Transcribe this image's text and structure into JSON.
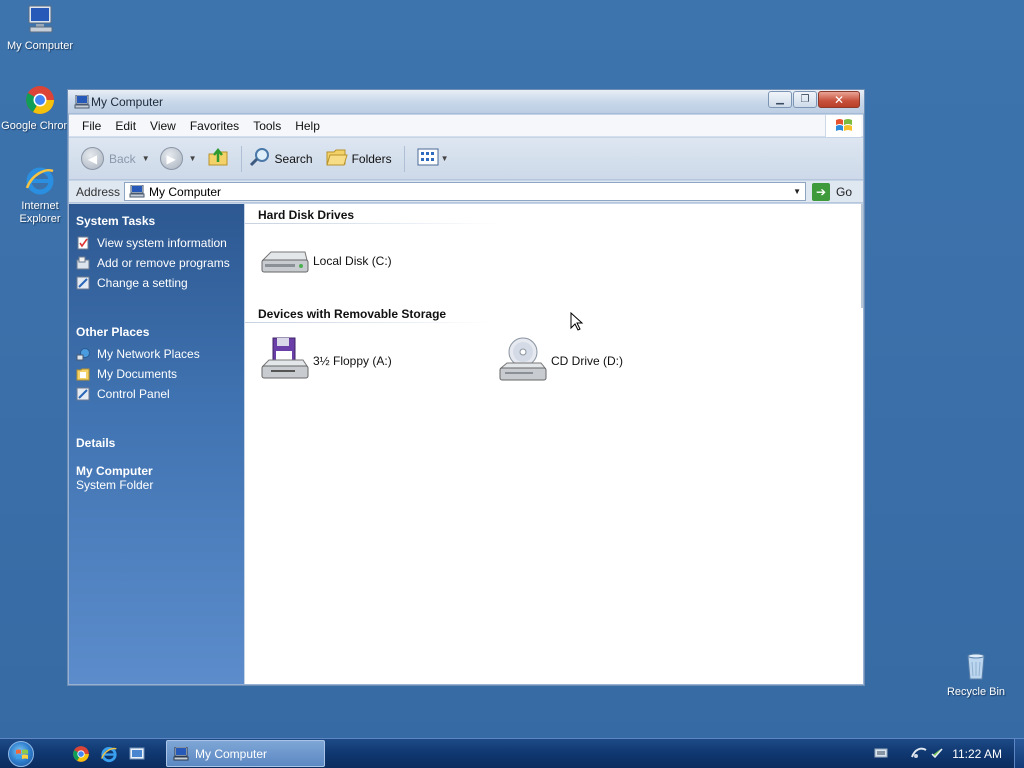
{
  "desktop": {
    "icons": [
      {
        "label": "My Computer",
        "icon": "my-computer-icon"
      },
      {
        "label": "Google Chrome",
        "icon": "chrome-icon"
      },
      {
        "label": "Internet Explorer",
        "icon": "internet-explorer-icon"
      },
      {
        "label": "Recycle Bin",
        "icon": "recycle-bin-icon"
      }
    ]
  },
  "window": {
    "title": "My Computer",
    "menu": [
      "File",
      "Edit",
      "View",
      "Favorites",
      "Tools",
      "Help"
    ],
    "toolbar": {
      "back_label": "Back",
      "search_label": "Search",
      "folders_label": "Folders"
    },
    "address": {
      "label": "Address",
      "value": "My Computer",
      "go_label": "Go"
    },
    "taskpane": {
      "system_tasks": {
        "title": "System Tasks",
        "items": [
          "View system information",
          "Add or remove programs",
          "Change a setting"
        ]
      },
      "other_places": {
        "title": "Other Places",
        "items": [
          "My Network Places",
          "My Documents",
          "Control Panel"
        ]
      },
      "details": {
        "title": "Details",
        "name": "My Computer",
        "type": "System Folder"
      }
    },
    "content": {
      "groups": [
        {
          "title": "Hard Disk Drives",
          "items": [
            {
              "label": "Local Disk (C:)",
              "icon": "hard-disk-icon"
            }
          ]
        },
        {
          "title": "Devices with Removable Storage",
          "items": [
            {
              "label": "3½ Floppy (A:)",
              "icon": "floppy-drive-icon"
            },
            {
              "label": "CD Drive (D:)",
              "icon": "cd-drive-icon"
            }
          ]
        }
      ]
    }
  },
  "taskbar": {
    "active_task": "My Computer",
    "clock": "11:22 AM"
  },
  "colors": {
    "desktop": "#3a6ea8",
    "taskpane": "#3f72b0",
    "close_button": "#c6503a",
    "taskbar": "#0f3770"
  }
}
